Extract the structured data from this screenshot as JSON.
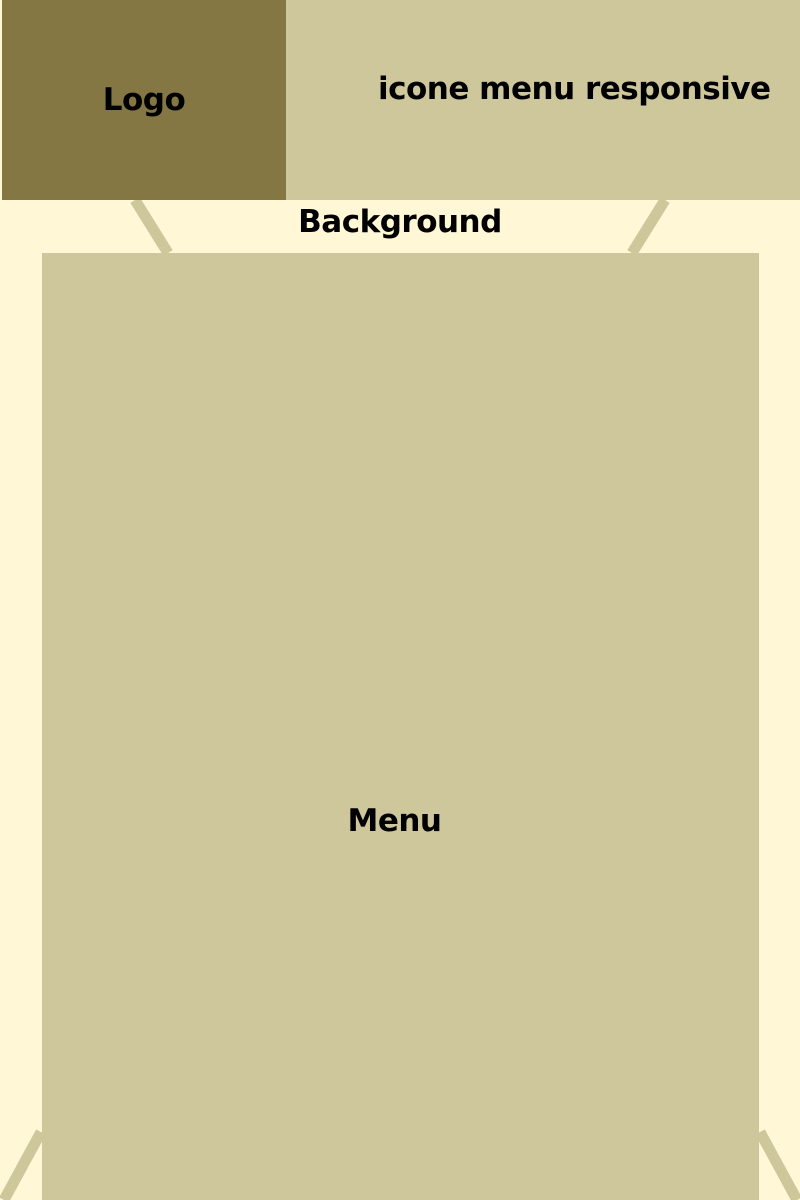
{
  "header": {
    "logo_label": "Logo",
    "menu_icon_label": "icone menu responsive"
  },
  "background": {
    "label": "Background"
  },
  "menu": {
    "label": "Menu"
  },
  "colors": {
    "page_background": "#fff7d6",
    "logo_block": "#857744",
    "panel": "#cfc79c",
    "line": "#cfc79c",
    "text": "#000000"
  }
}
